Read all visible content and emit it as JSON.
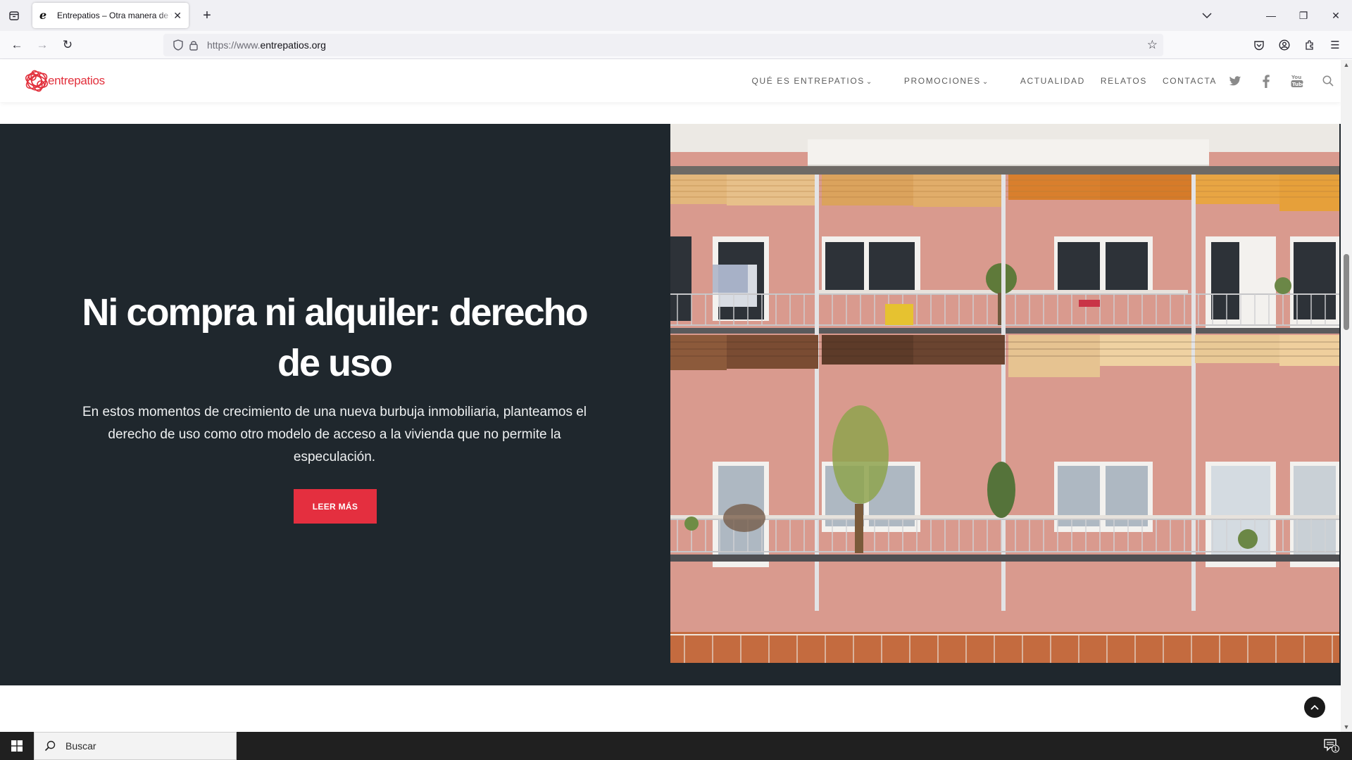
{
  "browser": {
    "tab_title": "Entrepatios – Otra manera de vivir",
    "url_prefix": "https://www.",
    "url_domain": "entrepatios.org",
    "icons": [
      "tab-list-icon",
      "close-icon",
      "plus-icon",
      "chevron-down-icon",
      "minimize-icon",
      "restore-icon",
      "back-icon",
      "forward-icon",
      "reload-icon",
      "shield-icon",
      "lock-icon",
      "star-icon",
      "pocket-icon",
      "account-icon",
      "extensions-icon",
      "menu-icon"
    ]
  },
  "site": {
    "logo_text": "entrepatios",
    "nav": {
      "que_es": "QUÉ ES ENTREPATIOS",
      "promociones": "PROMOCIONES",
      "actualidad": "ACTUALIDAD",
      "relatos": "RELATOS",
      "contacta": "CONTACTA"
    },
    "social_icons": [
      "twitter-icon",
      "facebook-icon",
      "youtube-icon",
      "search-icon"
    ],
    "hero": {
      "title_line1": "Ni compra ni alquiler: derecho",
      "title_line2": "de uso",
      "description": "En estos momentos de crecimiento de una nueva burbuja inmobiliaria, planteamos el derecho de uso como otro modelo de acceso a la vivienda que no permite la especulación.",
      "cta_label": "LEER MÁS"
    },
    "colors": {
      "brand_red": "#e42f3f",
      "hero_bg": "#1f272d",
      "facade": "#d99388"
    }
  },
  "taskbar": {
    "search_placeholder": "Buscar",
    "notification_count": "1"
  }
}
